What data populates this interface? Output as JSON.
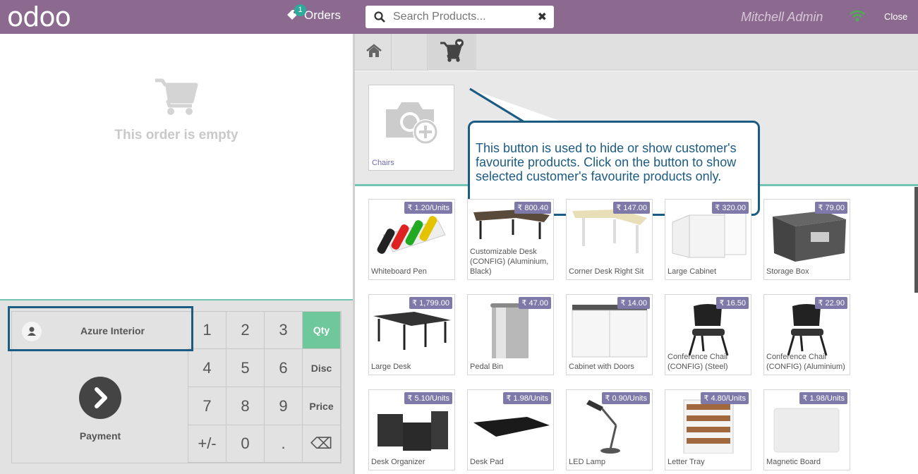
{
  "topbar": {
    "logo": "odoo",
    "orders_label": "Orders",
    "orders_count": "1",
    "search_placeholder": "Search Products...",
    "user": "Mitchell Admin",
    "close_label": "Close"
  },
  "order": {
    "empty_text": "This order is empty"
  },
  "controls": {
    "customer": "Azure Interior",
    "payment": "Payment",
    "keys": [
      "1",
      "2",
      "3",
      "Qty",
      "4",
      "5",
      "6",
      "Disc",
      "7",
      "8",
      "9",
      "Price",
      "+/-",
      "0",
      ".",
      "⌫"
    ],
    "active_mode": "Qty"
  },
  "categories": [
    {
      "name": "Chairs"
    }
  ],
  "tooltip": {
    "text": "This button is used to hide or show customer's favourite products. Click on the button to show selected customer's favourite products only."
  },
  "products": [
    {
      "name": "Whiteboard Pen",
      "price": "₹ 1.20/Units"
    },
    {
      "name": "Customizable Desk (CONFIG) (Aluminium, Black)",
      "price": "₹ 800.40"
    },
    {
      "name": "Corner Desk Right Sit",
      "price": "₹ 147.00"
    },
    {
      "name": "Large Cabinet",
      "price": "₹ 320.00"
    },
    {
      "name": "Storage Box",
      "price": "₹ 79.00"
    },
    {
      "name": "Large Desk",
      "price": "₹ 1,799.00"
    },
    {
      "name": "Pedal Bin",
      "price": "₹ 47.00"
    },
    {
      "name": "Cabinet with Doors",
      "price": "₹ 14.00"
    },
    {
      "name": "Conference Chair (CONFIG) (Steel)",
      "price": "₹ 16.50"
    },
    {
      "name": "Conference Chair (CONFIG) (Aluminium)",
      "price": "₹ 22.90"
    },
    {
      "name": "Desk Organizer",
      "price": "₹ 5.10/Units"
    },
    {
      "name": "Desk Pad",
      "price": "₹ 1.98/Units"
    },
    {
      "name": "LED Lamp",
      "price": "₹ 0.90/Units"
    },
    {
      "name": "Letter Tray",
      "price": "₹ 4.80/Units"
    },
    {
      "name": "Magnetic Board",
      "price": "₹ 1.98/Units"
    }
  ]
}
